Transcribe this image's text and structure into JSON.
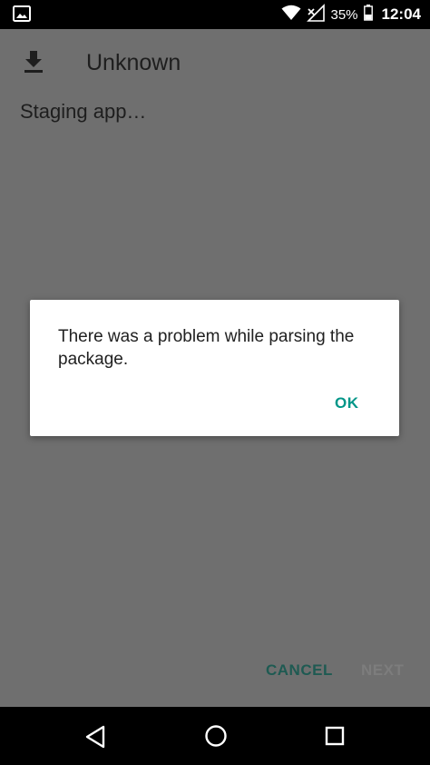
{
  "status_bar": {
    "icons": [
      "image-notification-icon",
      "wifi-icon",
      "signal-icon"
    ],
    "battery_percent": "35%",
    "time": "12:04"
  },
  "app": {
    "title": "Unknown",
    "status_text": "Staging app…",
    "buttons": {
      "cancel": "CANCEL",
      "next": "NEXT"
    }
  },
  "dialog": {
    "message": "There was a problem while parsing the package.",
    "ok_label": "OK",
    "accent_color": "#009688"
  },
  "nav_bar": {
    "icons": [
      "back-icon",
      "home-icon",
      "recents-icon"
    ]
  }
}
